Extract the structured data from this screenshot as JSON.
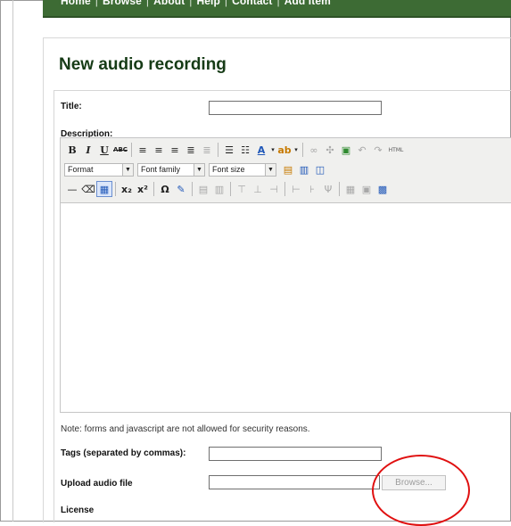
{
  "nav": {
    "items": [
      "Home",
      "Browse",
      "About",
      "Help",
      "Contact",
      "Add Item"
    ]
  },
  "page_title": "New audio recording",
  "form": {
    "title_label": "Title:",
    "title_value": "",
    "description_label": "Description:",
    "editor": {
      "format_label": "Format",
      "font_family_label": "Font family",
      "font_size_label": "Font size",
      "html_label": "HTML",
      "content": ""
    },
    "note": "Note: forms and javascript are not allowed for security reasons.",
    "tags_label": "Tags (separated by commas):",
    "tags_value": "",
    "upload_label": "Upload audio file",
    "upload_value": "",
    "browse_label": "Browse...",
    "license_label": "License"
  },
  "colors": {
    "nav_bg": "#3d6b34",
    "title_color": "#163b16",
    "highlight_circle": "#e01010"
  }
}
